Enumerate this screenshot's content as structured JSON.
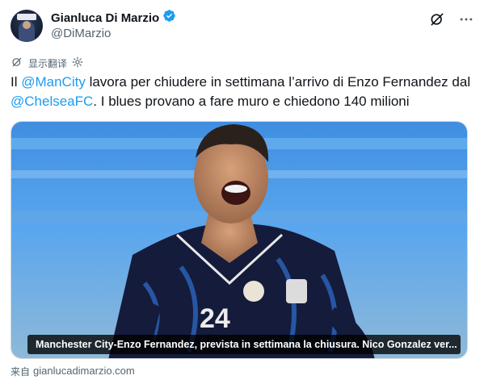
{
  "author": {
    "name": "Gianluca Di Marzio",
    "handle": "@DiMarzio"
  },
  "translate": {
    "label": "显示翻译"
  },
  "tweet": {
    "prefix": "Il ",
    "mention1": "@ManCity",
    "mid": " lavora per chiudere in settimana l’arrivo di Enzo Fernandez dal ",
    "mention2": "@ChelseaFC",
    "suffix": ". I blues provano a fare muro e chiedono 140 milioni"
  },
  "card": {
    "caption": "Manchester City-Enzo Fernandez, prevista in settimana la chiusura. Nico Gonzalez ver..."
  },
  "source": {
    "prefix": "来自",
    "domain": "gianlucadimarzio.com"
  },
  "icons": {
    "verified": "verified-badge-icon",
    "grok": "grok-icon",
    "more": "more-icon",
    "translate": "translate-icon",
    "settings": "gear-icon"
  },
  "colors": {
    "accent": "#1d9bf0",
    "text": "#0f1419",
    "muted": "#536471"
  }
}
